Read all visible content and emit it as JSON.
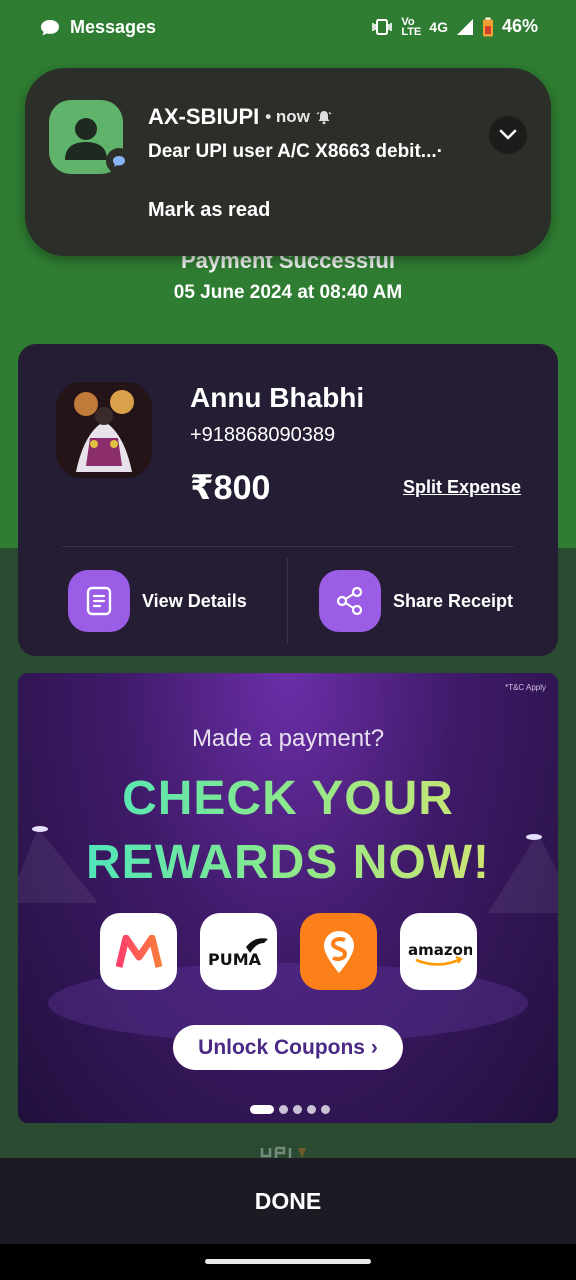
{
  "status_bar": {
    "app_name": "Messages",
    "network_top": "Vo",
    "network_bottom": "LTE",
    "network_type": "4G",
    "battery": "46%"
  },
  "notification": {
    "sender": "AX-SBIUPI",
    "time": "• now",
    "message": "Dear UPI user A/C X8663 debit...·",
    "action": "Mark as read"
  },
  "payment": {
    "status": "Payment Successful",
    "datetime": "05 June 2024 at 08:40 AM"
  },
  "payee": {
    "name": "Annu Bhabhi",
    "phone": "+918868090389",
    "amount": "₹800",
    "split_label": "Split Expense",
    "view_details": "View Details",
    "share_receipt": "Share Receipt"
  },
  "banner": {
    "tc": "*T&C Apply",
    "subtitle": "Made a payment?",
    "headline_1": "CHECK YOUR",
    "headline_2": "REWARDS NOW!",
    "brands": [
      "myntra-logo",
      "PUMA",
      "swiggy-logo",
      "amazon"
    ],
    "cta": "Unlock Coupons ›",
    "slide_count": 5,
    "active_slide": 1
  },
  "footer": {
    "done": "DONE"
  },
  "colors": {
    "top_bg": "#2f7d32",
    "card": "#241d33",
    "accent": "#9b5de5"
  }
}
